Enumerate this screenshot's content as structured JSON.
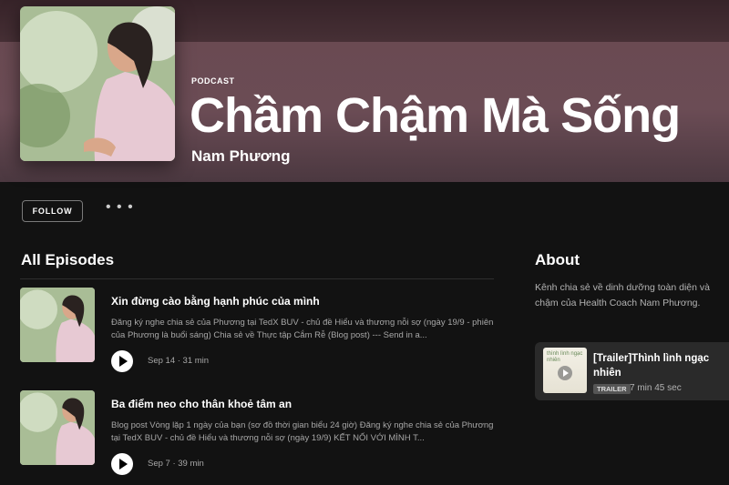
{
  "nav": {
    "back_icon": "‹",
    "forward_icon": "›"
  },
  "header": {
    "type_label": "PODCAST",
    "title": "Chầm Chậm Mà Sống",
    "author": "Nam Phương"
  },
  "actions": {
    "follow_label": "FOLLOW",
    "more_label": "• • •"
  },
  "episodes_section": {
    "title": "All Episodes",
    "items": [
      {
        "title": "Xin đừng cào bằng hạnh phúc của mình",
        "description": "Đăng ký nghe chia sẻ của Phương tại TedX BUV - chủ đề Hiểu và thương nỗi sợ (ngày 19/9 - phiên của Phương là buổi sáng) Chia sẻ về Thực tập Cắm Rễ (Blog post) --- Send in a...",
        "meta": "Sep 14 · 31 min"
      },
      {
        "title": "Ba điểm neo cho thân khoẻ tâm an",
        "description": "Blog post Vòng lặp 1 ngày của bạn (sơ đồ thời gian biểu 24 giờ) Đăng ký nghe chia sẻ của Phương tại TedX BUV - chủ đề Hiểu và thương nỗi sợ (ngày 19/9) KẾT NỐI VỚI MÌNH T...",
        "meta": "Sep 7 · 39 min"
      }
    ]
  },
  "about": {
    "title": "About",
    "text": "Kênh chia sẻ về dinh dưỡng toàn diện và chậm của Health Coach Nam Phương."
  },
  "trailer": {
    "thumb_text": "thình lình ngạc nhiên",
    "title": "[Trailer]Thình lình ngạc nhiên",
    "badge": "TRAILER",
    "duration": "7 min 45 sec"
  }
}
